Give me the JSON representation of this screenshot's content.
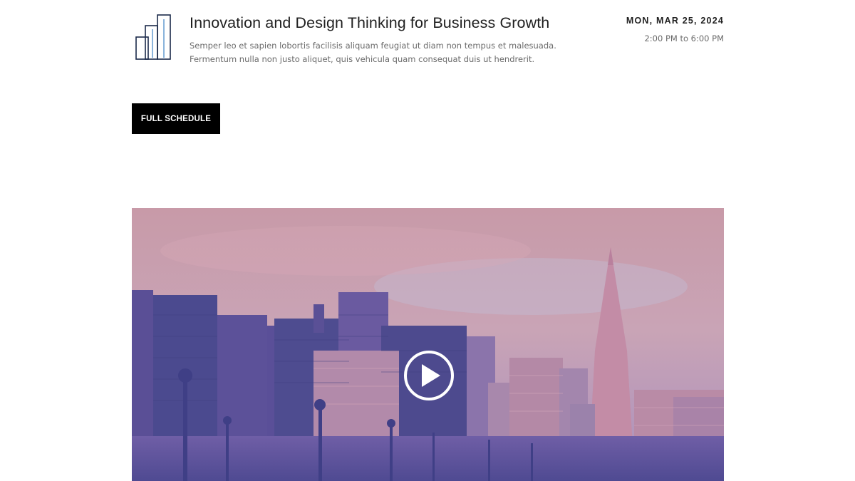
{
  "event": {
    "icon": "bar-chart-icon",
    "title": "Innovation and Design Thinking for Business Growth",
    "description": "Semper leo et sapien lobortis facilisis aliquam feugiat ut diam non tempus et malesuada. Fermentum nulla non justo aliquet, quis vehicula quam consequat duis ut hendrerit.",
    "date": "MON, MAR 25, 2024",
    "time": "2:00 PM to 6:00 PM"
  },
  "schedule_button": {
    "label": "FULL SCHEDULE"
  },
  "video": {
    "icon": "play-icon",
    "colors": {
      "sky_top": "#c79aa8",
      "sky_bottom": "#b08fb6",
      "building_dark": "#4c4b8f",
      "building_mid": "#6a5fa3",
      "building_light": "#b98aa8",
      "tower": "#c08aa2"
    }
  }
}
